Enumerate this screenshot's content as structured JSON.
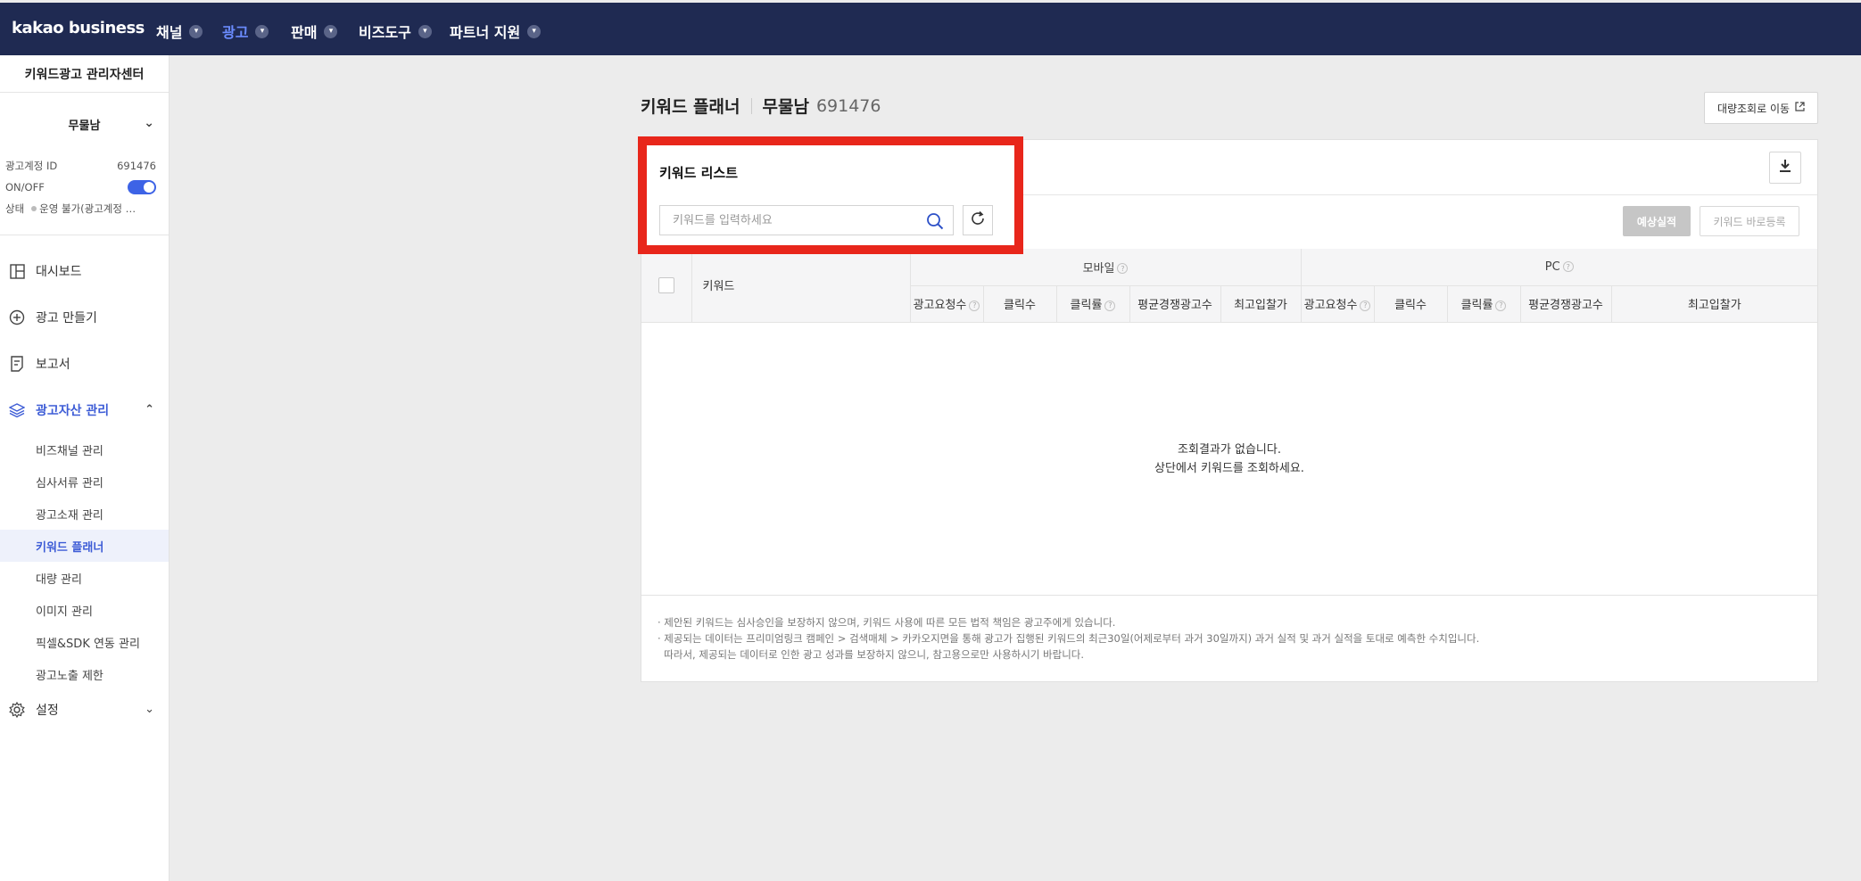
{
  "topnav": {
    "brand": "kakao business",
    "items": [
      {
        "label": "채널"
      },
      {
        "label": "광고"
      },
      {
        "label": "판매"
      },
      {
        "label": "비즈도구"
      },
      {
        "label": "파트너 지원"
      }
    ]
  },
  "sidebar": {
    "title": "키워드광고 관리자센터",
    "account_name": "무물남",
    "account_id_label": "광고계정 ID",
    "account_id": "691476",
    "onoff_label": "ON/OFF",
    "status_label": "상태",
    "status_value": "운영 불가(광고계정 …",
    "menu": [
      {
        "label": "대시보드"
      },
      {
        "label": "광고 만들기"
      },
      {
        "label": "보고서"
      },
      {
        "label": "광고자산 관리"
      }
    ],
    "sub_items": [
      {
        "label": "비즈채널 관리"
      },
      {
        "label": "심사서류 관리"
      },
      {
        "label": "광고소재 관리"
      },
      {
        "label": "키워드 플래너"
      },
      {
        "label": "대량 관리"
      },
      {
        "label": "이미지 관리"
      },
      {
        "label": "픽셀&SDK 연동 관리"
      },
      {
        "label": "광고노출 제한"
      }
    ],
    "settings": "설정"
  },
  "header": {
    "title": "키워드 플래너",
    "account_name": "무물남",
    "account_id": "691476",
    "bulk_button": "대량조회로 이동"
  },
  "keyword_list": {
    "title": "키워드 리스트",
    "search_placeholder": "키워드를 입력하세요",
    "search_value": ""
  },
  "actions": {
    "estimate": "예상실적",
    "register": "키워드 바로등록"
  },
  "table": {
    "keyword_col": "키워드",
    "mobile_group": "모바일",
    "pc_group": "PC",
    "mobile_cols": [
      "광고요청수",
      "클릭수",
      "클릭률",
      "평균경쟁광고수",
      "최고입찰가"
    ],
    "pc_cols": [
      "광고요청수",
      "클릭수",
      "클릭률",
      "평균경쟁광고수",
      "최고입찰가"
    ]
  },
  "empty": {
    "line1": "조회결과가 없습니다.",
    "line2": "상단에서 키워드를 조회하세요."
  },
  "notes": [
    "· 제안된 키워드는 심사승인을 보장하지 않으며, 키워드 사용에 따른 모든 법적 책임은 광고주에게 있습니다.",
    "· 제공되는 데이터는 프리미엄링크 캠페인 > 검색매체 > 카카오지면을 통해 광고가 집행된 키워드의 최근30일(어제로부터 과거 30일까지) 과거 실적 및 과거 실적을 토대로 예측한 수치입니다.",
    "  따라서, 제공되는 데이터로 인한 광고 성과를 보장하지 않으니, 참고용으로만 사용하시기 바랍니다."
  ],
  "colors": {
    "nav_bg": "#1f2a52",
    "accent": "#3d5cd6",
    "highlight": "#e8261b"
  }
}
